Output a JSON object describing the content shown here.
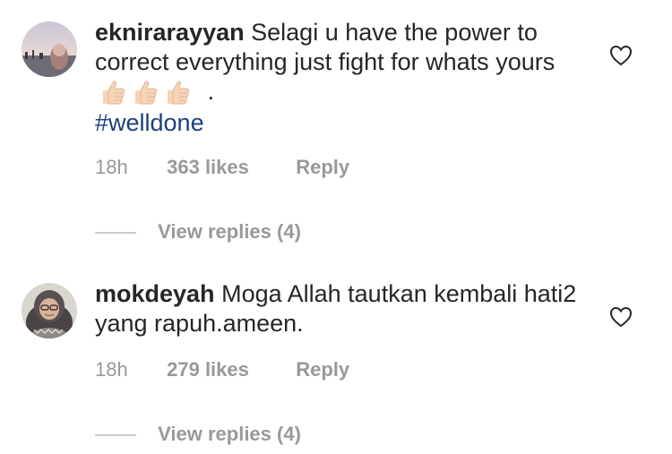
{
  "comments": [
    {
      "username": "eknirarayyan",
      "text": "Selagi u have the power to correct everything just fight for whats yours",
      "emoji_icon": "thumbs-up-icon",
      "emoji_count": 3,
      "trailing": ".",
      "hashtag": "#welldone",
      "time": "18h",
      "likes": "363 likes",
      "reply_label": "Reply",
      "view_replies": "View replies (4)"
    },
    {
      "username": "mokdeyah",
      "text": "Moga Allah tautkan kembali hati2 yang rapuh.ameen.",
      "time": "18h",
      "likes": "279 likes",
      "reply_label": "Reply",
      "view_replies": "View replies (4)"
    }
  ],
  "colors": {
    "text": "#262626",
    "meta": "#999999",
    "hashtag": "#1d3f7a",
    "divider": "#cccccc"
  }
}
